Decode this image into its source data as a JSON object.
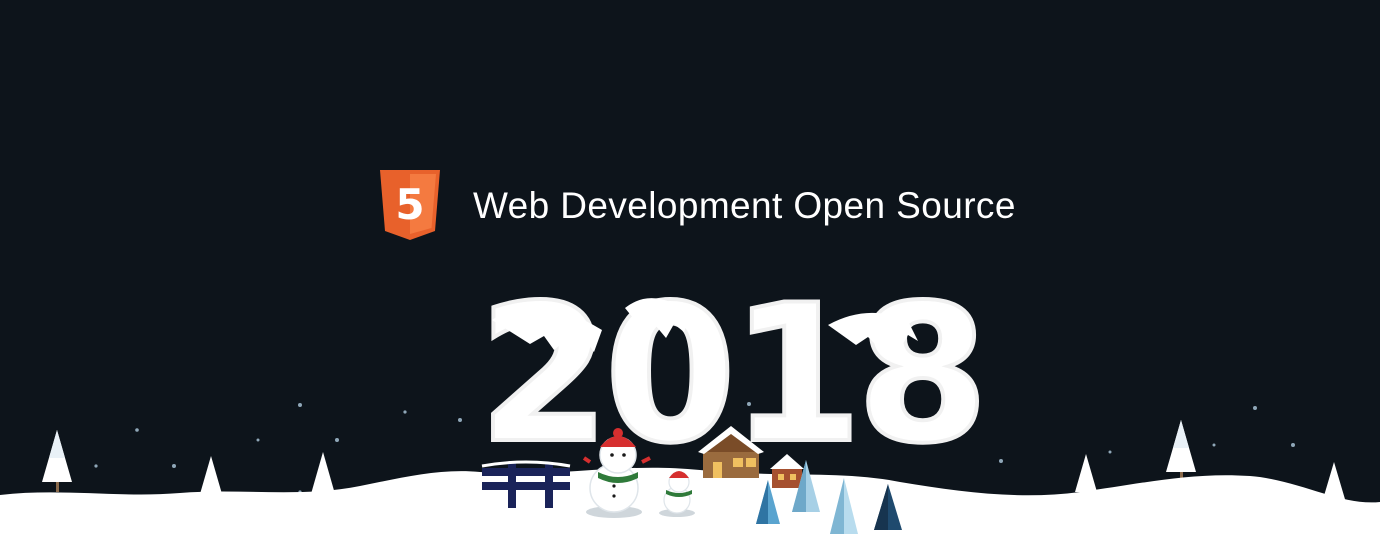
{
  "header": {
    "logo_text": "5",
    "title": "Web Development Open Source"
  },
  "artwork": {
    "year": "2018",
    "theme": "winter snow scene",
    "elements": [
      "snowy-hills",
      "snow-trees",
      "snowflakes",
      "snowmen",
      "cabins",
      "fence",
      "ice-trees"
    ]
  },
  "colors": {
    "background": "#0d141b",
    "title_text": "#ffffff",
    "logo_orange": "#e8612b",
    "logo_light_orange": "#f47a40",
    "snow": "#ffffff",
    "fence_navy": "#1a2359"
  }
}
